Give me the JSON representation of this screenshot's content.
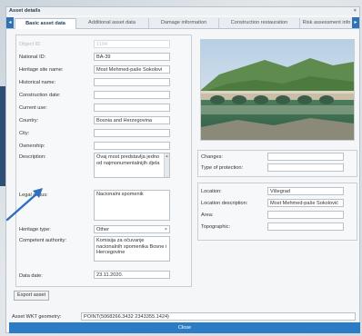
{
  "dialog": {
    "title": "Asset details",
    "close_glyph": "×"
  },
  "tabs": {
    "prev": "◂",
    "items": [
      "Basic asset data",
      "Additional asset data",
      "Damage information",
      "Construction restauration",
      "Risk assessment info"
    ],
    "next": "▸"
  },
  "ghost": {
    "label1": "Object ID",
    "value1": "1104"
  },
  "fields": [
    {
      "label": "National ID:",
      "value": "BA-39"
    },
    {
      "label": "Heritage site name:",
      "value": "Most Mehmed-paše Sokolovi"
    },
    {
      "label": "Historical name:",
      "value": ""
    },
    {
      "label": "Construction date:",
      "value": ""
    },
    {
      "label": "Current use:",
      "value": ""
    },
    {
      "label": "Country:",
      "value": "Bosnia and Herzegovina"
    },
    {
      "label": "City:",
      "value": ""
    },
    {
      "label": "Ownership:",
      "value": ""
    }
  ],
  "description": {
    "label": "Description:",
    "text": "Ovaj most predstavlja jedno od najmonumentalnijih djela"
  },
  "legal_status": {
    "label": "Legal status:",
    "text": "Nacionalni spomenik"
  },
  "heritage_type": {
    "label": "Heritage type:",
    "value": "Other",
    "clear": "×"
  },
  "competent_authority": {
    "label": "Competent authority:",
    "text": "Komisija za očuvanje nacionalnih spomenika Bosne i Hercegovine"
  },
  "data_date": {
    "label": "Data date:",
    "value": "23.11.2020."
  },
  "export_button": "Export asset",
  "right_top": [
    {
      "label": "Changes:",
      "value": ""
    },
    {
      "label": "Type of protection:",
      "value": ""
    }
  ],
  "location": [
    {
      "label": "Location:",
      "value": "Višegrad"
    },
    {
      "label": "Location description:",
      "value": "Most Mehmed-paše Sokolović"
    },
    {
      "label": "Area:",
      "value": ""
    },
    {
      "label": "Topographic:",
      "value": ""
    }
  ],
  "geometry": {
    "label": "Asset WKT geometry:",
    "value": "POINT(5068266.3432 2343355.1424)"
  },
  "close_button": "Close",
  "colors": {
    "accent": "#2c7cc5",
    "arrow": "#2f6fc0"
  }
}
